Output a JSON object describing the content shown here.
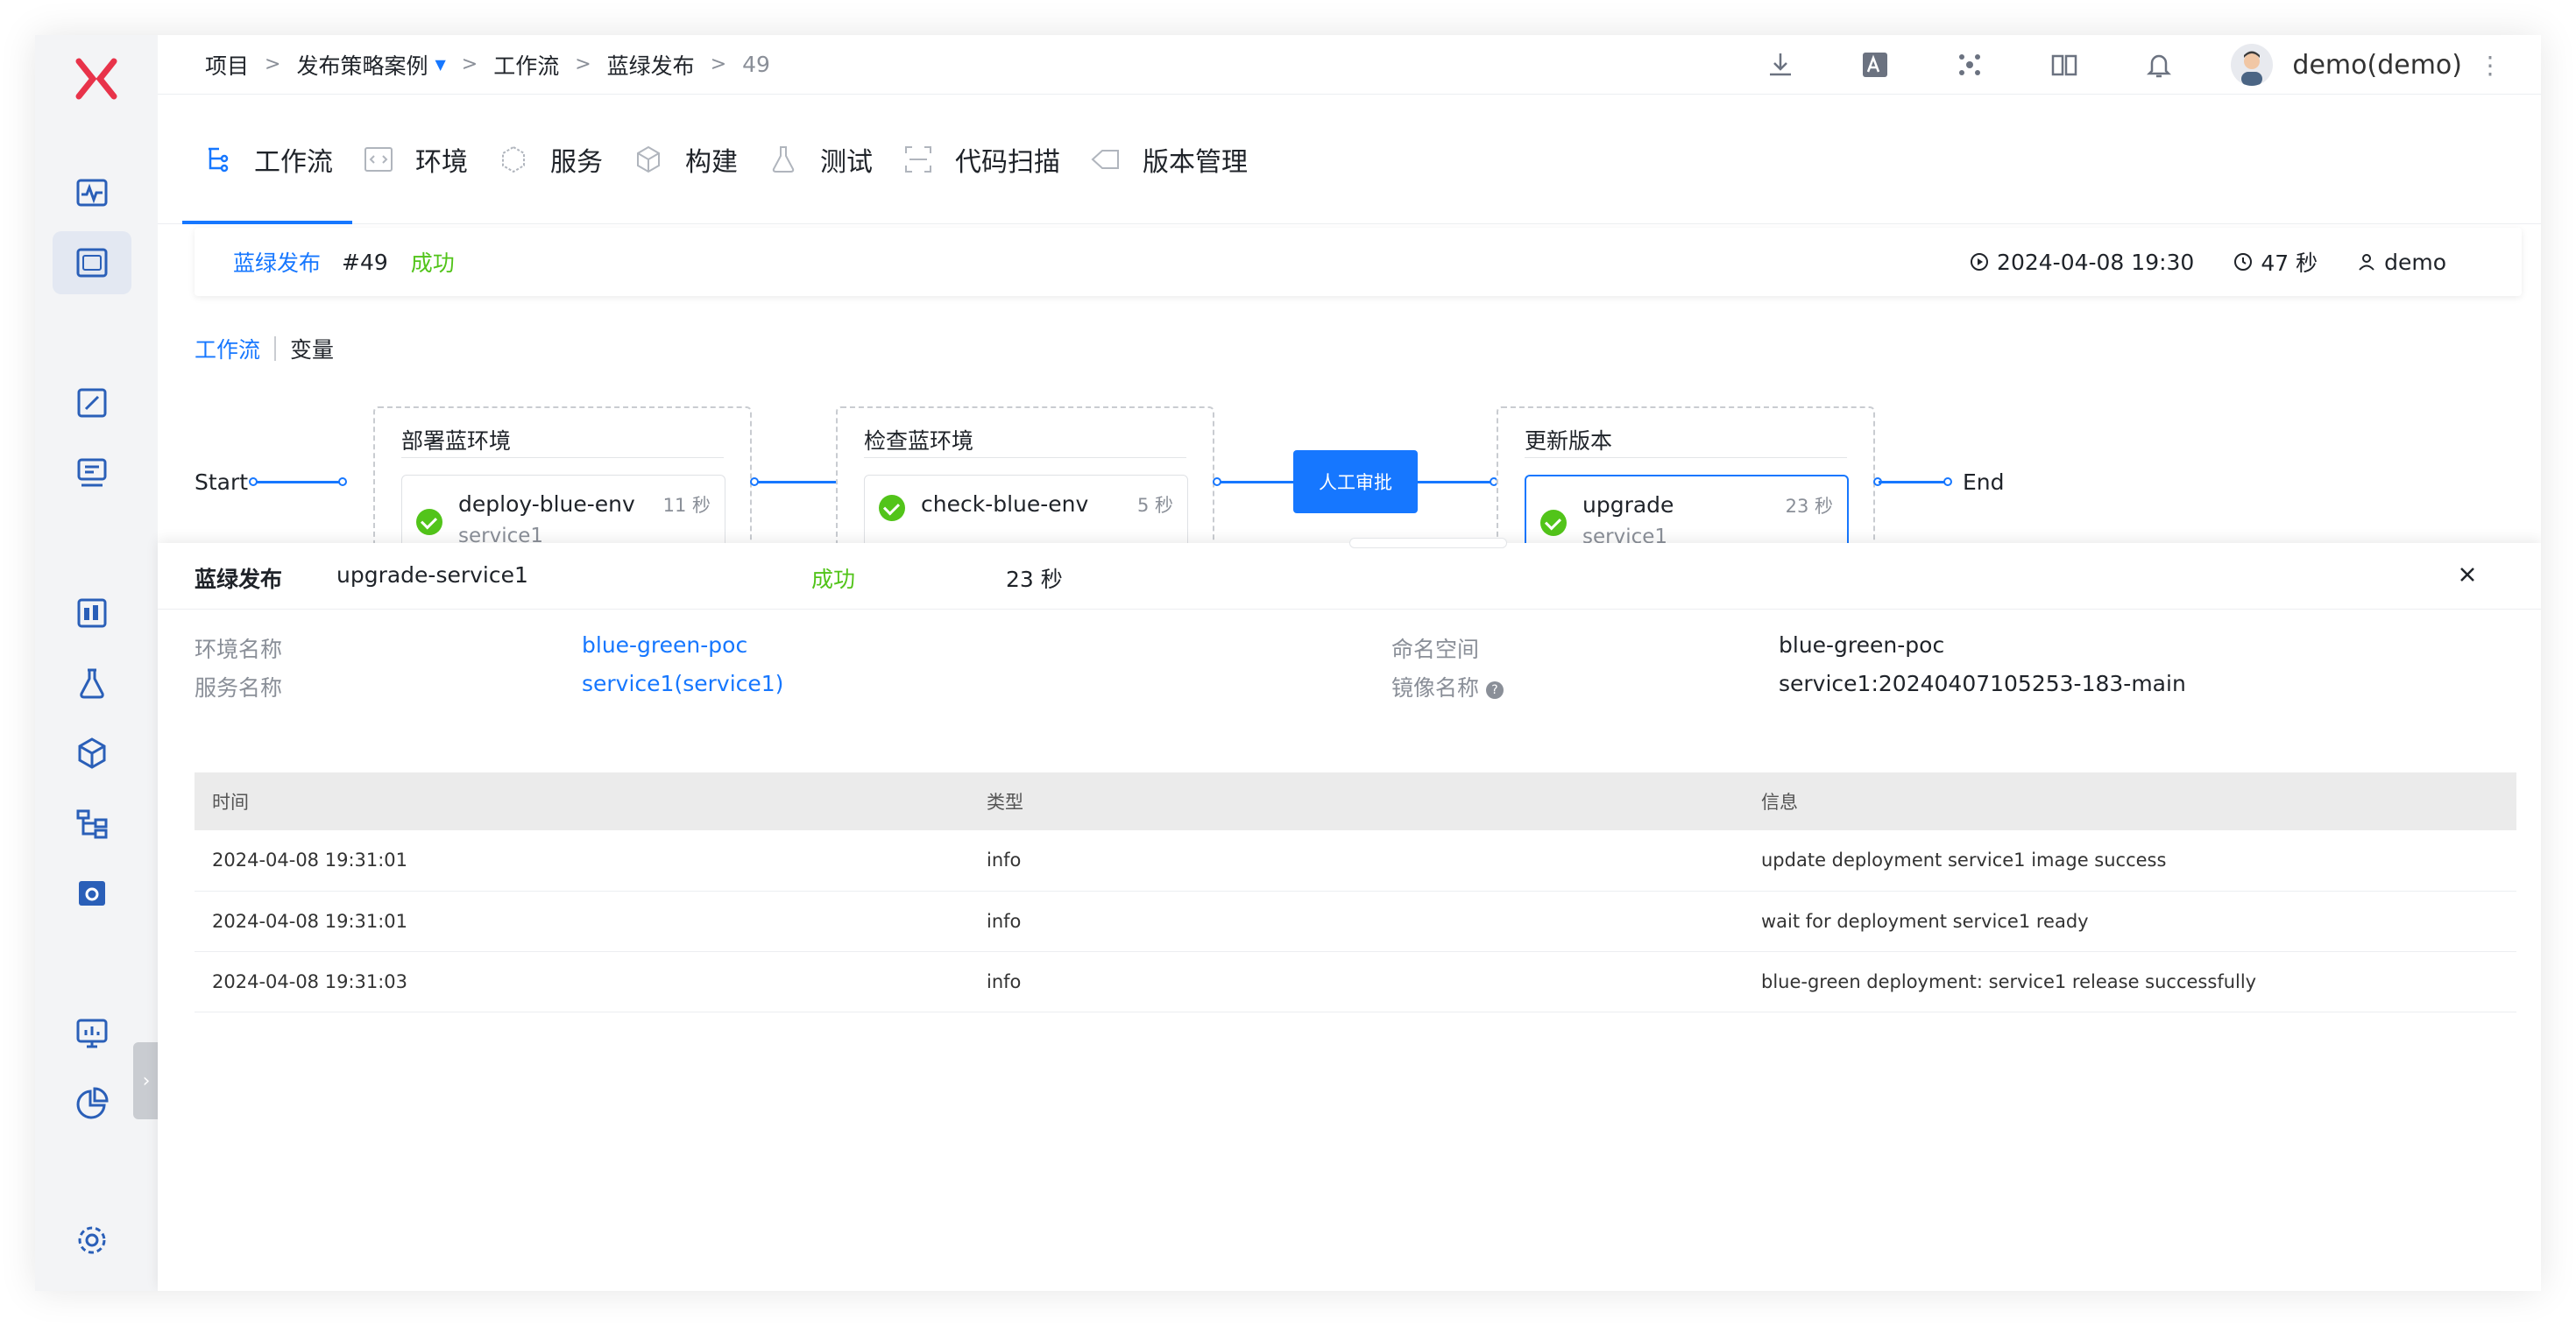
{
  "breadcrumb": {
    "items": [
      "项目",
      "发布策略案例",
      "工作流",
      "蓝绿发布",
      "49"
    ]
  },
  "user": {
    "name": "demo(demo)"
  },
  "module_tabs": [
    "工作流",
    "环境",
    "服务",
    "构建",
    "测试",
    "代码扫描",
    "版本管理"
  ],
  "run": {
    "workflow_name": "蓝绿发布",
    "number": "#49",
    "status": "成功",
    "start_time": "2024-04-08 19:30",
    "duration": "47 秒",
    "operator": "demo"
  },
  "subtabs": [
    "工作流",
    "变量"
  ],
  "pipeline": {
    "start_label": "Start",
    "end_label": "End",
    "stages": [
      {
        "title": "部署蓝环境",
        "job": {
          "name": "deploy-blue-env",
          "service": "service1",
          "duration": "11 秒"
        }
      },
      {
        "title": "检查蓝环境",
        "job": {
          "name": "check-blue-env",
          "duration": "5 秒"
        }
      },
      {
        "title": "更新版本",
        "job": {
          "name": "upgrade",
          "service": "service1",
          "duration": "23 秒"
        }
      }
    ],
    "approval_label": "人工审批"
  },
  "drawer": {
    "workflow_name": "蓝绿发布",
    "job_name": "upgrade-service1",
    "status": "成功",
    "duration": "23 秒",
    "fields": {
      "env_label": "环境名称",
      "env_value": "blue-green-poc",
      "namespace_label": "命名空间",
      "namespace_value": "blue-green-poc",
      "service_label": "服务名称",
      "service_value": "service1(service1)",
      "image_label": "镜像名称",
      "image_value": "service1:20240407105253-183-main"
    },
    "table": {
      "headers": [
        "时间",
        "类型",
        "信息"
      ],
      "rows": [
        [
          "2024-04-08 19:31:01",
          "info",
          "update deployment service1 image success"
        ],
        [
          "2024-04-08 19:31:01",
          "info",
          "wait for deployment service1 ready"
        ],
        [
          "2024-04-08 19:31:03",
          "info",
          "blue-green deployment: service1 release successfully"
        ]
      ]
    }
  },
  "colors": {
    "primary": "#1677ff",
    "success": "#52c41a",
    "brand": "#e8334a"
  }
}
